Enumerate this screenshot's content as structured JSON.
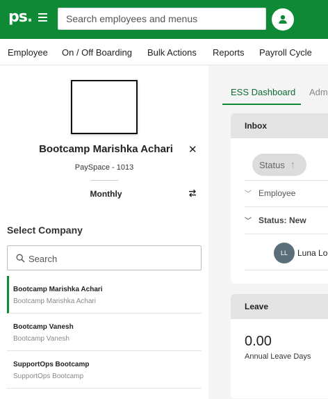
{
  "header": {
    "logo_text": "ps",
    "logo_dot": ".",
    "search_placeholder": "Search employees and menus",
    "brand_color": "#0e8a37"
  },
  "menu": {
    "items": [
      "Employee",
      "On / Off Boarding",
      "Bulk Actions",
      "Reports",
      "Payroll Cycle"
    ]
  },
  "employee": {
    "name": "Bootcamp Marishka Achari",
    "company_code": "PaySpace - 1013",
    "frequency": "Monthly"
  },
  "company_selector": {
    "title": "Select Company",
    "search_placeholder": "Search",
    "companies": [
      {
        "title": "Bootcamp Marishka Achari",
        "subtitle": "Bootcamp Marishka Achari",
        "active": true
      },
      {
        "title": "Bootcamp Vanesh",
        "subtitle": "Bootcamp Vanesh",
        "active": false
      },
      {
        "title": "SupportOps Bootcamp",
        "subtitle": "SupportOps Bootcamp",
        "active": false
      }
    ]
  },
  "tabs": {
    "active": "ESS Dashboard",
    "next": "Adm"
  },
  "inbox": {
    "title": "Inbox",
    "status_chip": "Status",
    "group_employee": "Employee",
    "group_status": "Status: New",
    "person_initials": "LL",
    "person_name": "Luna Lo"
  },
  "leave": {
    "title": "Leave",
    "value": "0.00",
    "label": "Annual Leave Days"
  }
}
